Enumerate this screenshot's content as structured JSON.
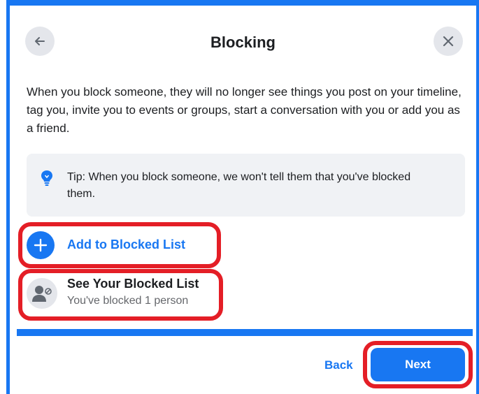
{
  "dialog": {
    "title": "Blocking",
    "back_icon": "arrow-left-icon",
    "close_icon": "close-icon",
    "description": "When you block someone, they will no longer see things you post on your timeline, tag you, invite you to events or groups, start a conversation with you or add you as a friend."
  },
  "tip": {
    "icon": "lightbulb-icon",
    "text": "Tip: When you block someone, we won't tell them that you've blocked them."
  },
  "actions": {
    "add": {
      "label": "Add to Blocked List",
      "icon": "plus-icon"
    },
    "see": {
      "label": "See Your Blocked List",
      "subtitle": "You've blocked 1 person",
      "icon": "blocked-user-icon"
    }
  },
  "progress": {
    "value": 1.0
  },
  "footer": {
    "back_label": "Back",
    "next_label": "Next"
  },
  "colors": {
    "accent": "#1877f2",
    "highlight": "#e41e26",
    "surface": "#f0f2f5",
    "secondary_text": "#65676b"
  }
}
